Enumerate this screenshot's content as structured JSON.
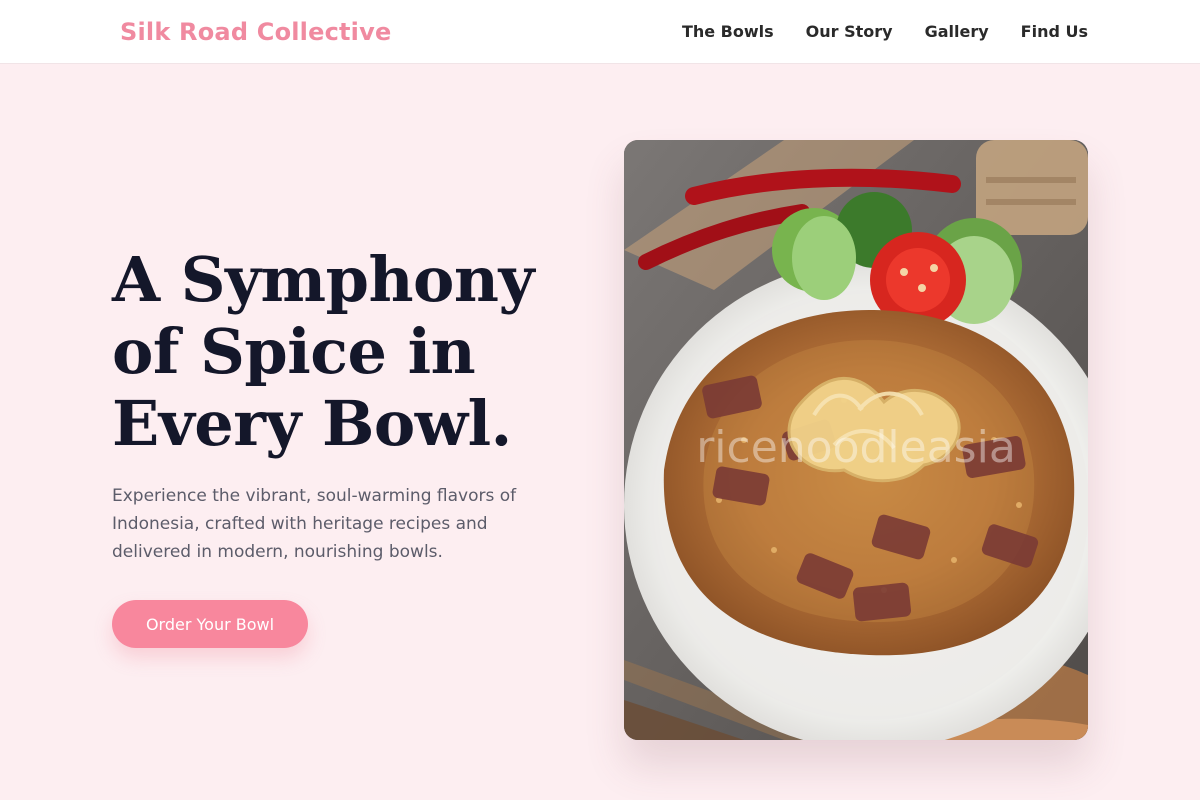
{
  "header": {
    "brand": "Silk Road Collective",
    "nav": [
      {
        "label": "The Bowls"
      },
      {
        "label": "Our Story"
      },
      {
        "label": "Gallery"
      },
      {
        "label": "Find Us"
      }
    ]
  },
  "hero": {
    "headline": "A Symphony of Spice in Every Bowl.",
    "subtext": "Experience the vibrant, soul-warming flavors of Indonesia, crafted with heritage recipes and delivered in modern, nourishing bowls.",
    "cta": "Order Your Bowl",
    "image": {
      "subject": "Indonesian fried rice bowl",
      "watermark": "ricenoodleasia"
    }
  },
  "colors": {
    "background": "#fdeef1",
    "brand": "#f08aa0",
    "cta": "#f8879d",
    "headline": "#14172a",
    "body": "#5c5c6a"
  }
}
